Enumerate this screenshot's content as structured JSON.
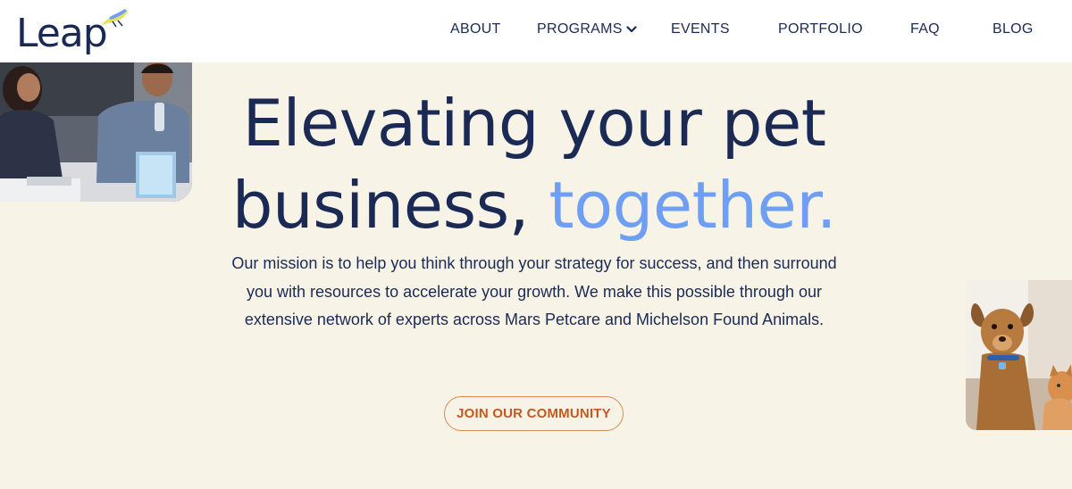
{
  "brand": {
    "logo_text": "Leap",
    "accent_color": "#6e9ff2",
    "navy_color": "#1b2a55",
    "cta_color": "#c4581e"
  },
  "nav": {
    "items": [
      {
        "label": "ABOUT"
      },
      {
        "label": "PROGRAMS",
        "icon": "chevron-down-icon"
      },
      {
        "label": "EVENTS"
      },
      {
        "label": "PORTFOLIO"
      },
      {
        "label": "FAQ"
      },
      {
        "label": "BLOG"
      }
    ]
  },
  "hero": {
    "headline_line1": "Elevating your pet",
    "headline_line2_start": "business, ",
    "headline_accent": "together.",
    "mission": "Our mission is to help you think through your strategy for success, and then surround you with resources to accelerate your growth. We make this possible through our extensive network of experts across Mars Petcare and Michelson Found Animals.",
    "cta_label": "JOIN OUR COMMUNITY"
  }
}
